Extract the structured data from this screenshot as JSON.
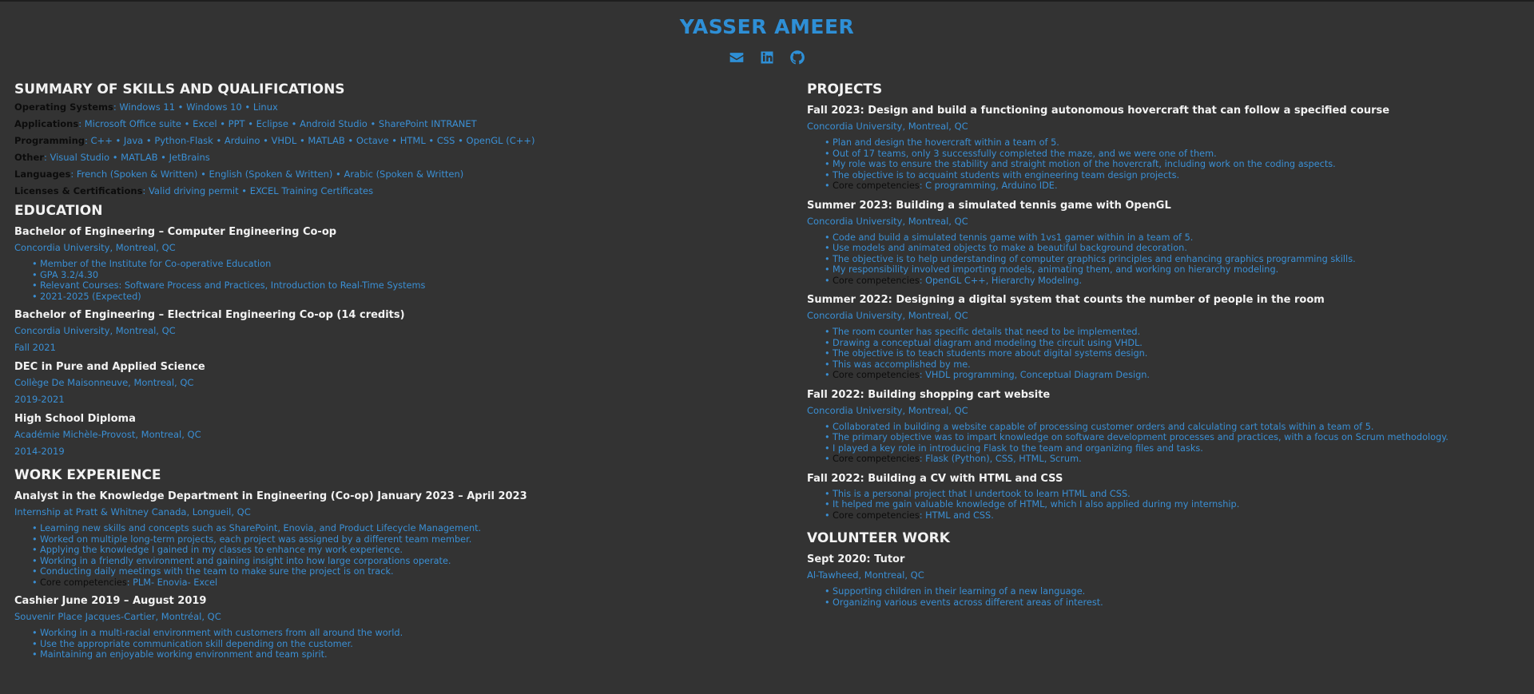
{
  "name": "YASSER AMEER",
  "icons": [
    "email-icon",
    "linkedin-icon",
    "github-icon"
  ],
  "colors": {
    "background": "#333333",
    "accent": "#3a8fd4",
    "name": "#2e8fd6"
  },
  "skills": {
    "title": "SUMMARY OF SKILLS AND QUALIFICATIONS",
    "rows": [
      {
        "label": "Operating Systems",
        "value": "Windows 11 • Windows 10 • Linux"
      },
      {
        "label": "Applications",
        "value": "Microsoft Office suite • Excel • PPT • Eclipse • Android Studio • SharePoint INTRANET"
      },
      {
        "label": "Programming",
        "value": "C++ • Java • Python-Flask • Arduino • VHDL • MATLAB • Octave • HTML • CSS • OpenGL (C++)"
      },
      {
        "label": "Other",
        "value": "Visual Studio • MATLAB • JetBrains"
      },
      {
        "label": "Languages",
        "value": "French (Spoken & Written) • English (Spoken & Written) • Arabic (Spoken & Written)"
      },
      {
        "label": "Licenses & Certifications",
        "value": "Valid driving permit • EXCEL Training Certificates"
      }
    ]
  },
  "education": {
    "title": "EDUCATION",
    "entries": [
      {
        "title": "Bachelor of Engineering – Computer Engineering Co-op",
        "place": "Concordia University, Montreal, QC",
        "items": [
          "Member of the Institute for Co-operative Education",
          "GPA 3.2/4.30",
          "Relevant Courses: Software Process and Practices, Introduction to Real-Time Systems",
          "2021-2025 (Expected)"
        ]
      },
      {
        "title": "Bachelor of Engineering – Electrical Engineering Co-op (14 credits)",
        "place": "Concordia University, Montreal, QC",
        "date": "Fall 2021"
      },
      {
        "title": "DEC in Pure and Applied Science",
        "place": "Collège De Maisonneuve, Montreal, QC",
        "date": "2019-2021"
      },
      {
        "title": "High School Diploma",
        "place": "Académie Michèle-Provost, Montreal, QC",
        "date": "2014-2019"
      }
    ]
  },
  "work": {
    "title": "WORK EXPERIENCE",
    "entries": [
      {
        "title": "Analyst in the Knowledge Department in Engineering (Co-op) January 2023 – April 2023",
        "place": "Internship at Pratt & Whitney Canada, Longueil, QC",
        "items": [
          "Learning new skills and concepts such as SharePoint, Enovia, and Product Lifecycle Management.",
          "Worked on multiple long-term projects, each project was assigned by a different team member.",
          "Applying the knowledge I gained in my classes to enhance my work experience.",
          "Working in a friendly environment and gaining insight into how large corporations operate.",
          "Conducting daily meetings with the team to make sure the project is on track."
        ],
        "cc_label": "Core competencies",
        "cc_value": ": PLM- Enovia- Excel"
      },
      {
        "title": "Cashier June 2019 – August 2019",
        "place": "Souvenir Place Jacques-Cartier, Montréal, QC",
        "items": [
          "Working in a multi-racial environment with customers from all around the world.",
          "Use the appropriate communication skill depending on the customer.",
          "Maintaining an enjoyable working environment and team spirit."
        ]
      }
    ]
  },
  "projects": {
    "title": "PROJECTS",
    "entries": [
      {
        "title": "Fall 2023: Design and build a functioning autonomous hovercraft that can follow a specified course",
        "place": "Concordia University, Montreal, QC",
        "items": [
          "Plan and design the hovercraft within a team of 5.",
          "Out of 17 teams, only 3 successfully completed the maze, and we were one of them.",
          "My role was to ensure the stability and straight motion of the hovercraft, including work on the coding aspects.",
          "The objective is to acquaint students with engineering team design projects."
        ],
        "cc_label": "Core competencies",
        "cc_value": ": C programming, Arduino IDE."
      },
      {
        "title": "Summer 2023: Building a simulated tennis game with OpenGL",
        "place": "Concordia University, Montreal, QC",
        "items": [
          "Code and build a simulated tennis game with 1vs1 gamer within in a team of 5.",
          "Use models and animated objects to make a beautiful background decoration.",
          "The objective is to help understanding of computer graphics principles and enhancing graphics programming skills.",
          "My responsibility involved importing models, animating them, and working on hierarchy modeling."
        ],
        "cc_label": "Core competencies",
        "cc_value": ": OpenGL C++, Hierarchy Modeling."
      },
      {
        "title": "Summer 2022: Designing a digital system that counts the number of people in the room",
        "place": "Concordia University, Montreal, QC",
        "items": [
          "The room counter has specific details that need to be implemented.",
          "Drawing a conceptual diagram and modeling the circuit using VHDL.",
          "The objective is to teach students more about digital systems design.",
          "This was accomplished by me."
        ],
        "cc_label": "Core competencies",
        "cc_value": ": VHDL programming, Conceptual Diagram Design."
      },
      {
        "title": "Fall 2022: Building shopping cart website",
        "place": "Concordia University, Montreal, QC",
        "items": [
          "Collaborated in building a website capable of processing customer orders and calculating cart totals within a team of 5.",
          "The primary objective was to impart knowledge on software development processes and practices, with a focus on Scrum methodology.",
          "I played a key role in introducing Flask to the team and organizing files and tasks."
        ],
        "cc_label": "Core competencies",
        "cc_value": ": Flask (Python), CSS, HTML, Scrum."
      },
      {
        "title": "Fall 2022: Building a CV with HTML and CSS",
        "items": [
          "This is a personal project that I undertook to learn HTML and CSS.",
          "It helped me gain valuable knowledge of HTML, which I also applied during my internship."
        ],
        "cc_label": "Core competencies",
        "cc_value": ": HTML and CSS."
      }
    ]
  },
  "volunteer": {
    "title": "VOLUNTEER WORK",
    "entries": [
      {
        "title": "Sept 2020: Tutor",
        "place": "Al-Tawheed, Montreal, QC",
        "items": [
          "Supporting children in their learning of a new language.",
          "Organizing various events across different areas of interest."
        ]
      }
    ]
  }
}
